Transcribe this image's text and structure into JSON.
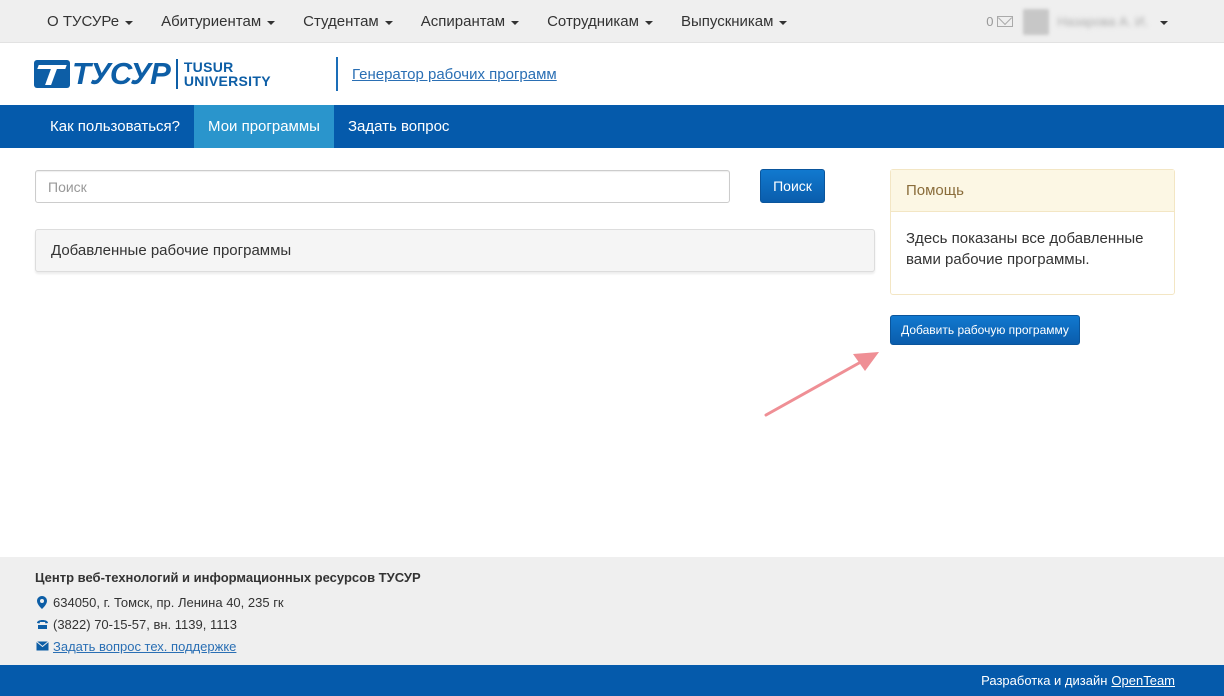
{
  "topnav": {
    "items": [
      {
        "label": "О ТУСУРе"
      },
      {
        "label": "Абитуриентам"
      },
      {
        "label": "Студентам"
      },
      {
        "label": "Аспирантам"
      },
      {
        "label": "Сотрудникам"
      },
      {
        "label": "Выпускникам"
      }
    ],
    "message_count": "0",
    "user_name": "Назарова А. И."
  },
  "header": {
    "logo_ru": "ТУСУР",
    "logo_en_line1": "TUSUR",
    "logo_en_line2": "UNIVERSITY",
    "app_link": "Генератор рабочих программ"
  },
  "mainnav": {
    "items": [
      {
        "label": "Как пользоваться?",
        "active": false
      },
      {
        "label": "Мои программы",
        "active": true
      },
      {
        "label": "Задать вопрос",
        "active": false
      }
    ]
  },
  "search": {
    "placeholder": "Поиск",
    "value": "",
    "button_label": "Поиск"
  },
  "programs_panel": {
    "title": "Добавленные рабочие программы"
  },
  "help": {
    "title": "Помощь",
    "text": "Здесь показаны все добавленные вами рабочие программы."
  },
  "add_button_label": "Добавить рабочую программу",
  "footer": {
    "title": "Центр веб-технологий и информационных ресурсов ТУСУР",
    "address": "634050, г. Томск, пр. Ленина 40, 235 гк",
    "phone": "(3822) 70-15-57, вн. 1139, 1113",
    "support_link": "Задать вопрос тех. поддержке",
    "credits_prefix": "Разработка и дизайн",
    "credits_link": "OpenTeam"
  },
  "colors": {
    "brand_blue": "#055aab",
    "active_tab": "#2a95cc",
    "help_heading_bg": "#fcf7e4",
    "annotation_arrow": "#ef8f95"
  }
}
